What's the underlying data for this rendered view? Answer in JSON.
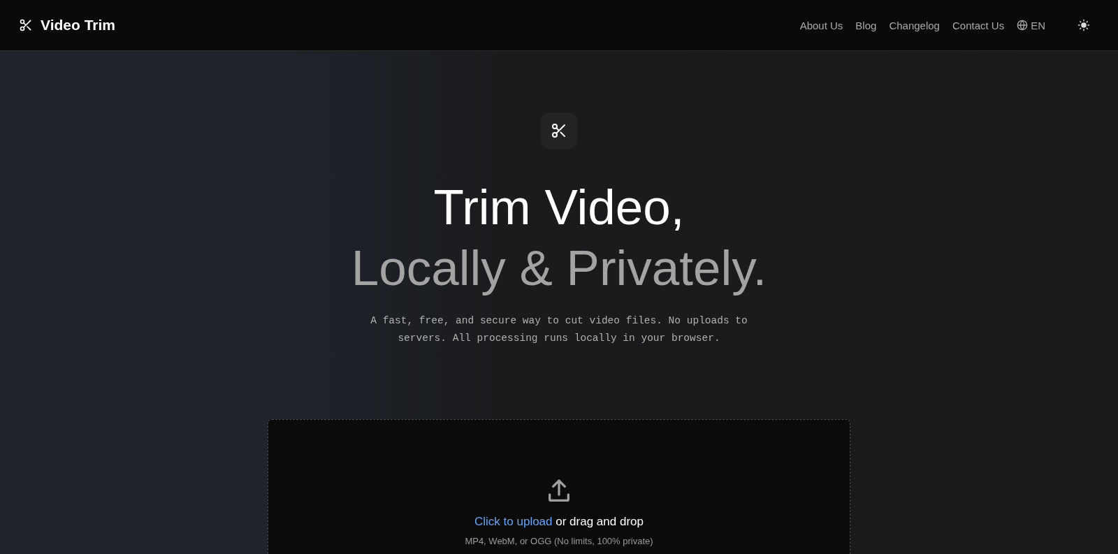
{
  "header": {
    "brand": "Video Trim",
    "nav": [
      {
        "label": "About Us"
      },
      {
        "label": "Blog"
      },
      {
        "label": "Changelog"
      },
      {
        "label": "Contact Us"
      }
    ],
    "language": "EN"
  },
  "hero": {
    "title_line_1": "Trim Video,",
    "title_line_2": "Locally & Privately.",
    "subtitle": "A fast, free, and secure way to cut video files. No uploads to servers. All processing runs locally in your browser."
  },
  "upload": {
    "link": "Click to upload",
    "prompt": "or drag and drop",
    "hint": "MP4, WebM, or OGG (No limits, 100% private)"
  }
}
